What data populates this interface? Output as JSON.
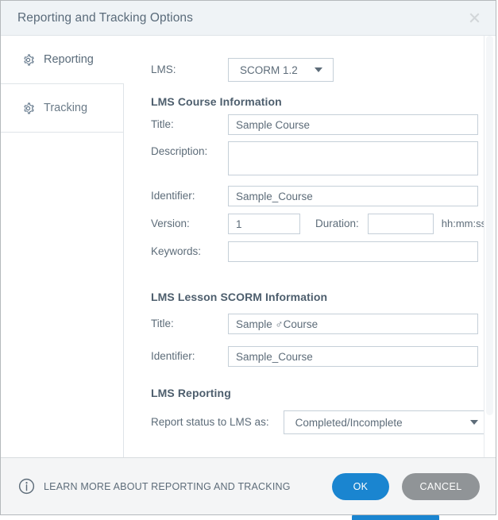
{
  "window": {
    "title": "Reporting and Tracking Options",
    "close_icon": "close-icon"
  },
  "sidebar": {
    "items": [
      {
        "label": "Reporting",
        "icon": "gear-icon",
        "active": true
      },
      {
        "label": "Tracking",
        "icon": "gear-icon",
        "active": false
      }
    ]
  },
  "form": {
    "lms": {
      "label": "LMS:",
      "value": "SCORM 1.2"
    },
    "course_section": {
      "heading": "LMS Course Information",
      "title_label": "Title:",
      "title_value": "Sample Course",
      "description_label": "Description:",
      "description_value": "",
      "identifier_label": "Identifier:",
      "identifier_value": "Sample_Course",
      "version_label": "Version:",
      "version_value": "1",
      "duration_label": "Duration:",
      "duration_value": "",
      "duration_format": "hh:mm:ss",
      "keywords_label": "Keywords:",
      "keywords_value": ""
    },
    "scorm_section": {
      "heading": "LMS Lesson SCORM Information",
      "title_label": "Title:",
      "title_value": "Sample ♂Course",
      "identifier_label": "Identifier:",
      "identifier_value": "Sample_Course"
    },
    "reporting_section": {
      "heading": "LMS Reporting",
      "status_label": "Report status to LMS as:",
      "status_value": "Completed/Incomplete"
    }
  },
  "footer": {
    "learn_more": "LEARN MORE ABOUT REPORTING AND TRACKING",
    "info_icon": "info-icon",
    "ok_label": "OK",
    "cancel_label": "CANCEL"
  },
  "colors": {
    "accent_blue": "#1a85d0",
    "cancel_gray": "#909497",
    "titlebar_bg": "#eff3f6",
    "footer_bg": "#f4f5f6",
    "field_border": "#c5cfd8",
    "label_text": "#5d6c79"
  }
}
